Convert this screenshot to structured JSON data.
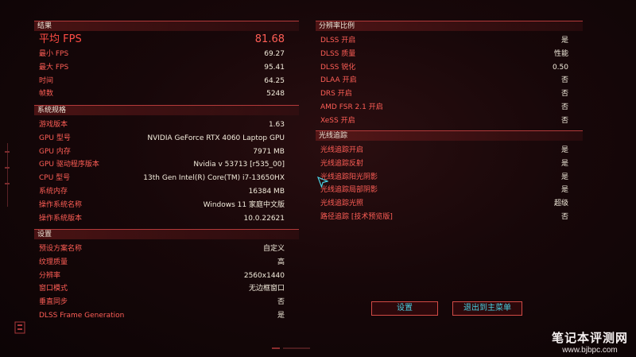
{
  "results": {
    "title": "结果",
    "avg_fps": {
      "label": "平均 FPS",
      "value": "81.68"
    },
    "rows": [
      {
        "label": "最小 FPS",
        "value": "69.27"
      },
      {
        "label": "最大 FPS",
        "value": "95.41"
      },
      {
        "label": "时间",
        "value": "64.25"
      },
      {
        "label": "帧数",
        "value": "5248"
      }
    ]
  },
  "system": {
    "title": "系统规格",
    "rows": [
      {
        "label": "游戏版本",
        "value": "1.63"
      },
      {
        "label": "GPU 型号",
        "value": "NVIDIA GeForce RTX 4060 Laptop GPU"
      },
      {
        "label": "GPU 内存",
        "value": "7971 MB"
      },
      {
        "label": "GPU 驱动程序版本",
        "value": "Nvidia v 53713 [r535_00]"
      },
      {
        "label": "CPU 型号",
        "value": "13th Gen Intel(R) Core(TM) i7-13650HX"
      },
      {
        "label": "系统内存",
        "value": "16384 MB"
      },
      {
        "label": "操作系统名称",
        "value": "Windows 11 家庭中文版"
      },
      {
        "label": "操作系统版本",
        "value": "10.0.22621"
      }
    ]
  },
  "settings": {
    "title": "设置",
    "rows": [
      {
        "label": "预设方案名称",
        "value": "自定义"
      },
      {
        "label": "纹理质量",
        "value": "高"
      },
      {
        "label": "分辨率",
        "value": "2560x1440"
      },
      {
        "label": "窗口模式",
        "value": "无边框窗口"
      },
      {
        "label": "垂直同步",
        "value": "否"
      },
      {
        "label": "DLSS Frame Generation",
        "value": "是"
      }
    ]
  },
  "resolution": {
    "title": "分辨率比例",
    "rows": [
      {
        "label": "DLSS 开启",
        "value": "是"
      },
      {
        "label": "DLSS 质量",
        "value": "性能"
      },
      {
        "label": "DLSS 锐化",
        "value": "0.50"
      },
      {
        "label": "DLAA 开启",
        "value": "否"
      },
      {
        "label": "DRS 开启",
        "value": "否"
      },
      {
        "label": "AMD FSR 2.1 开启",
        "value": "否"
      },
      {
        "label": "XeSS 开启",
        "value": "否"
      }
    ]
  },
  "raytracing": {
    "title": "光线追踪",
    "rows": [
      {
        "label": "光线追踪开启",
        "value": "是"
      },
      {
        "label": "光线追踪反射",
        "value": "是"
      },
      {
        "label": "光线追踪阳光阴影",
        "value": "是"
      },
      {
        "label": "光线追踪局部阴影",
        "value": "是"
      },
      {
        "label": "光线追踪光照",
        "value": "超级"
      },
      {
        "label": "路径追踪 [技术预览版]",
        "value": "否"
      }
    ]
  },
  "buttons": {
    "settings": "设置",
    "main_menu": "退出到主菜单"
  },
  "watermark": {
    "cn": "笔记本评测网",
    "url": "www.bjbpc.com"
  },
  "colors": {
    "label": "#ff5e56",
    "value": "#f3ecdc",
    "button_text": "#4ad0e2",
    "border": "#d24a45"
  }
}
